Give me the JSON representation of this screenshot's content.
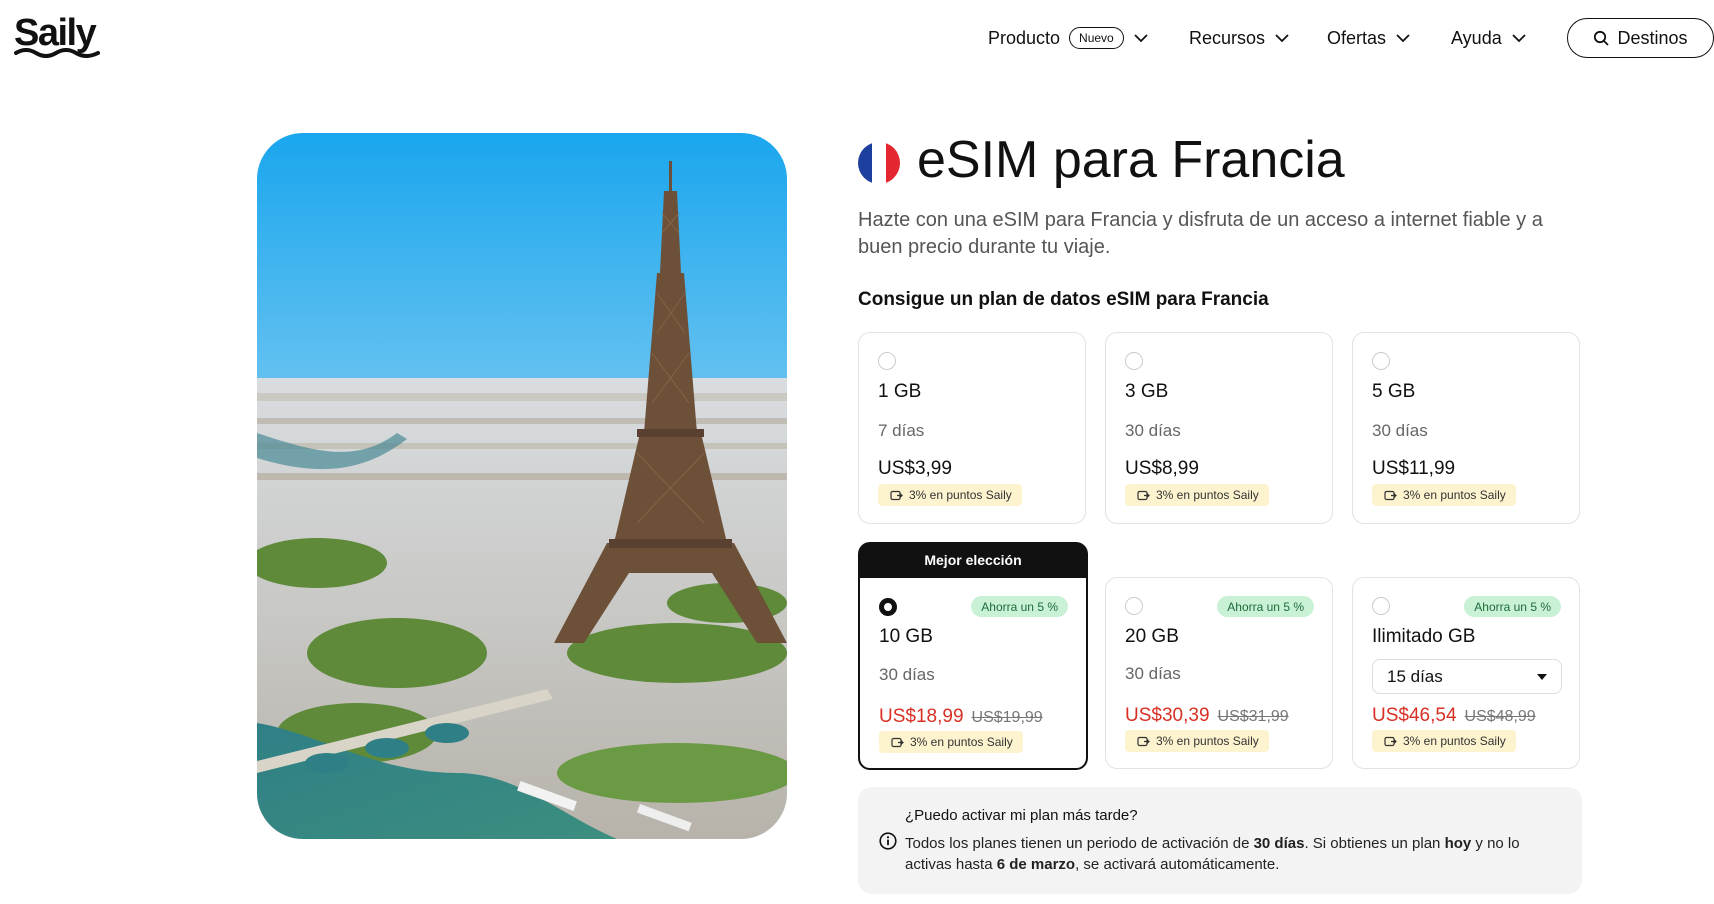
{
  "brand": {
    "name": "Saily"
  },
  "nav": {
    "product": "Producto",
    "product_badge": "Nuevo",
    "resources": "Recursos",
    "offers": "Ofertas",
    "help": "Ayuda",
    "search": "Destinos"
  },
  "page": {
    "title": "eSIM para Francia",
    "description": "Hazte con una eSIM para Francia y disfruta de un acceso a internet fiable y a buen precio durante tu viaje.",
    "subtitle": "Consigue un plan de datos eSIM para Francia",
    "best_choice": "Mejor elección"
  },
  "plans": [
    {
      "gb": "1 GB",
      "days": "7 días",
      "price": "US$3,99",
      "points": "3% en puntos Saily"
    },
    {
      "gb": "3 GB",
      "days": "30 días",
      "price": "US$8,99",
      "points": "3% en puntos Saily"
    },
    {
      "gb": "5 GB",
      "days": "30 días",
      "price": "US$11,99",
      "points": "3% en puntos Saily"
    },
    {
      "gb": "10 GB",
      "days": "30 días",
      "price": "US$18,99",
      "old_price": "US$19,99",
      "save": "Ahorra un 5 %",
      "points": "3% en puntos Saily",
      "selected": true
    },
    {
      "gb": "20 GB",
      "days": "30 días",
      "price": "US$30,39",
      "old_price": "US$31,99",
      "save": "Ahorra un 5 %",
      "points": "3% en puntos Saily"
    },
    {
      "gb": "Ilimitado GB",
      "days": "15 días",
      "price": "US$46,54",
      "old_price": "US$48,99",
      "save": "Ahorra un 5 %",
      "points": "3% en puntos Saily"
    }
  ],
  "info": {
    "question": "¿Puedo activar mi plan más tarde?",
    "t1": "Todos los planes tienen un periodo de activación de ",
    "b1": "30 días",
    "t2": ". Si obtienes un plan ",
    "b2": "hoy",
    "t3": " y no lo activas hasta ",
    "b3": "6 de marzo",
    "t4": ", se activará automáticamente."
  },
  "colors": {
    "sale": "#d93025",
    "save_badge_bg": "#c9f1d6",
    "points_bg": "#fdf3cf",
    "flag_blue": "#1d3f9e",
    "flag_red": "#e3262f"
  }
}
